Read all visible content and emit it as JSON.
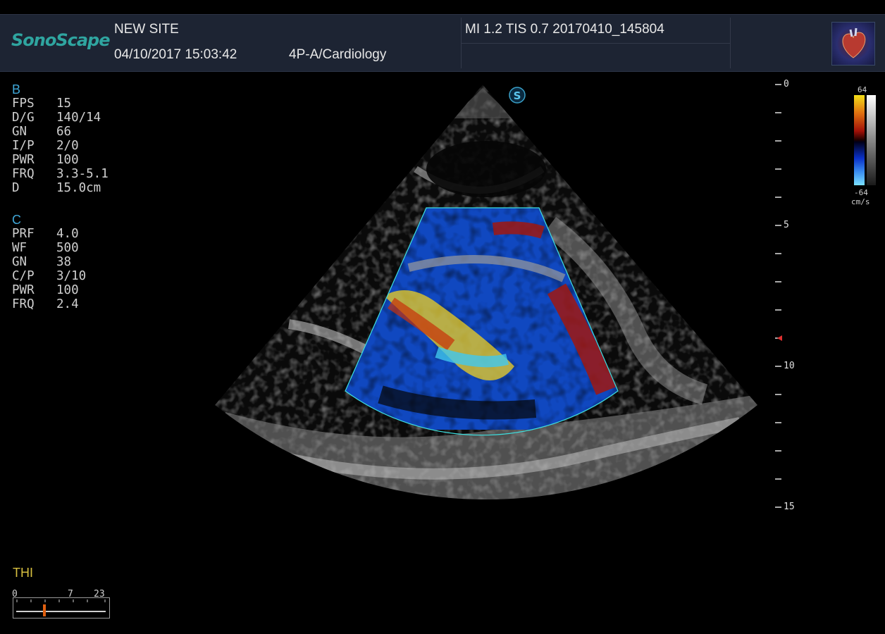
{
  "header": {
    "brand": "SonoScape",
    "site": "NEW SITE",
    "datetime": "04/10/2017 15:03:42",
    "probe_preset": "4P-A/Cardiology",
    "indices": "MI  1.2  TIS 0.7  20170410_145804"
  },
  "bmode": {
    "title": "B",
    "params": [
      {
        "k": "FPS",
        "v": "15"
      },
      {
        "k": "D/G",
        "v": "140/14"
      },
      {
        "k": "GN",
        "v": "66"
      },
      {
        "k": "I/P",
        "v": "2/0"
      },
      {
        "k": "PWR",
        "v": "100"
      },
      {
        "k": "FRQ",
        "v": "3.3-5.1"
      },
      {
        "k": "D",
        "v": "15.0cm"
      }
    ]
  },
  "color": {
    "title": "C",
    "params": [
      {
        "k": "PRF",
        "v": "4.0"
      },
      {
        "k": "WF",
        "v": "500"
      },
      {
        "k": "GN",
        "v": "38"
      },
      {
        "k": "C/P",
        "v": "3/10"
      },
      {
        "k": "PWR",
        "v": "100"
      },
      {
        "k": "FRQ",
        "v": "2.4"
      }
    ]
  },
  "depth_scale": {
    "labels": [
      "0",
      "5",
      "10",
      "15"
    ],
    "max": 15,
    "focus_depth": 9
  },
  "colorbar": {
    "top": "64",
    "bottom": "-64",
    "unit": "cm/s"
  },
  "thi": {
    "label": "THI",
    "scale": [
      "0",
      "7",
      "23"
    ],
    "marker_value": 7
  },
  "steer_icon": "S",
  "colors": {
    "accent": "#3fa7d8",
    "brand": "#2fa5a0",
    "thi": "#d8c040",
    "roi": "#3ee0e0"
  }
}
